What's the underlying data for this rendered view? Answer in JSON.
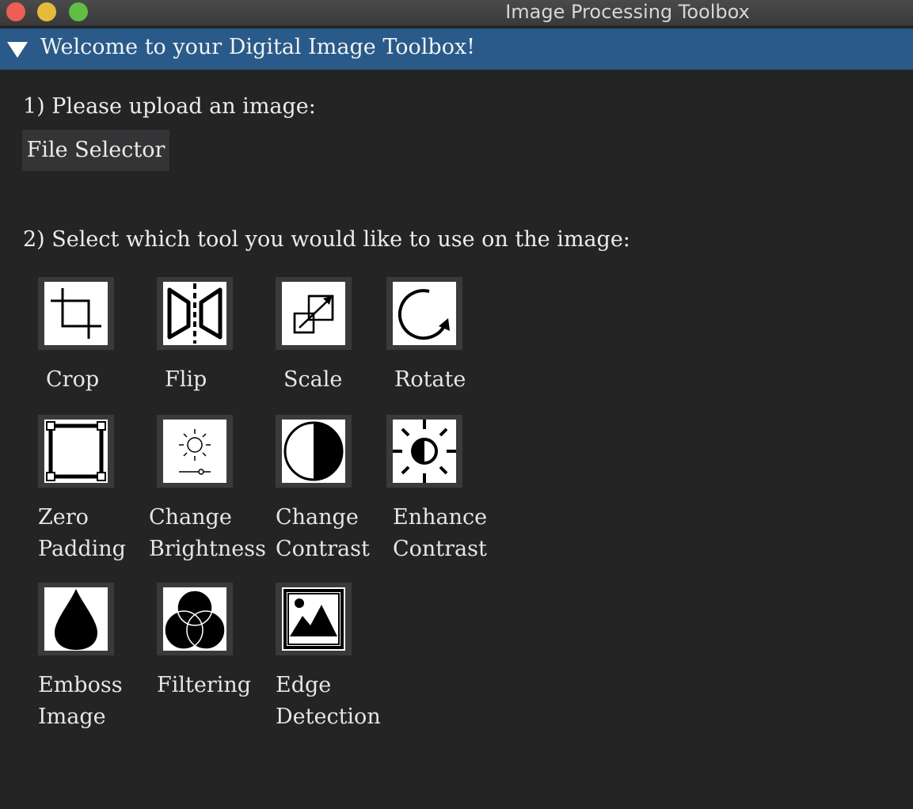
{
  "window": {
    "title": "Image Processing Toolbox"
  },
  "panel": {
    "title": "Welcome to your Digital Image Toolbox!"
  },
  "step1": {
    "label": "1) Please upload an image:",
    "button": "File Selector"
  },
  "step2": {
    "label": "2) Select which tool you would like to use on the image:"
  },
  "tools": [
    {
      "label": "Crop",
      "icon": "crop-icon"
    },
    {
      "label": "Flip",
      "icon": "flip-icon"
    },
    {
      "label": "Scale",
      "icon": "scale-icon"
    },
    {
      "label": "Rotate",
      "icon": "rotate-icon"
    },
    {
      "label": "Zero\nPadding",
      "icon": "zero-padding-icon"
    },
    {
      "label": "Change\nBrightness",
      "icon": "brightness-icon"
    },
    {
      "label": "Change\nContrast",
      "icon": "contrast-icon"
    },
    {
      "label": "Enhance\nContrast",
      "icon": "enhance-contrast-icon"
    },
    {
      "label": "Emboss\nImage",
      "icon": "emboss-icon"
    },
    {
      "label": "Filtering",
      "icon": "filter-icon"
    },
    {
      "label": "Edge\nDetection",
      "icon": "edge-detection-icon"
    }
  ]
}
